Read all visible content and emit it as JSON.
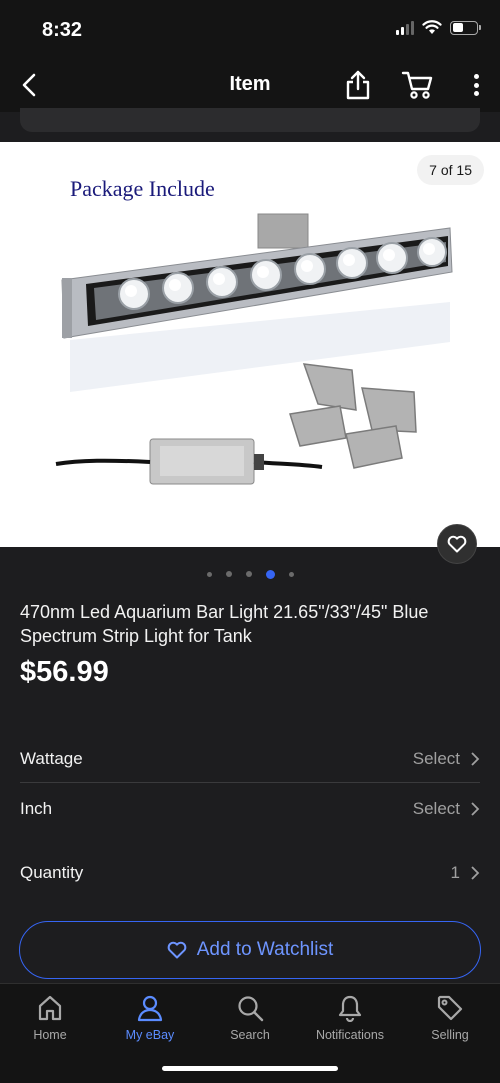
{
  "status_bar": {
    "time": "8:32"
  },
  "nav": {
    "title": "Item"
  },
  "gallery": {
    "counter": "7 of 15",
    "image_caption": "Package Include",
    "dots_total": 5,
    "dots_active_index": 3
  },
  "product": {
    "title": "470nm Led Aquarium Bar Light 21.65\"/33\"/45\" Blue Spectrum Strip Light for Tank",
    "price": "$56.99"
  },
  "options": [
    {
      "label": "Wattage",
      "value": "Select"
    },
    {
      "label": "Inch",
      "value": "Select"
    },
    {
      "label": "Quantity",
      "value": "1"
    }
  ],
  "watchlist_button": {
    "label": "Add to Watchlist"
  },
  "tabs": [
    {
      "label": "Home",
      "icon": "home-icon",
      "active": false
    },
    {
      "label": "My eBay",
      "icon": "person-icon",
      "active": true
    },
    {
      "label": "Search",
      "icon": "search-icon",
      "active": false
    },
    {
      "label": "Notifications",
      "icon": "bell-icon",
      "active": false
    },
    {
      "label": "Selling",
      "icon": "tag-icon",
      "active": false
    }
  ],
  "colors": {
    "accent": "#3665f3",
    "background": "#1d1d1f",
    "bar": "#141414"
  }
}
